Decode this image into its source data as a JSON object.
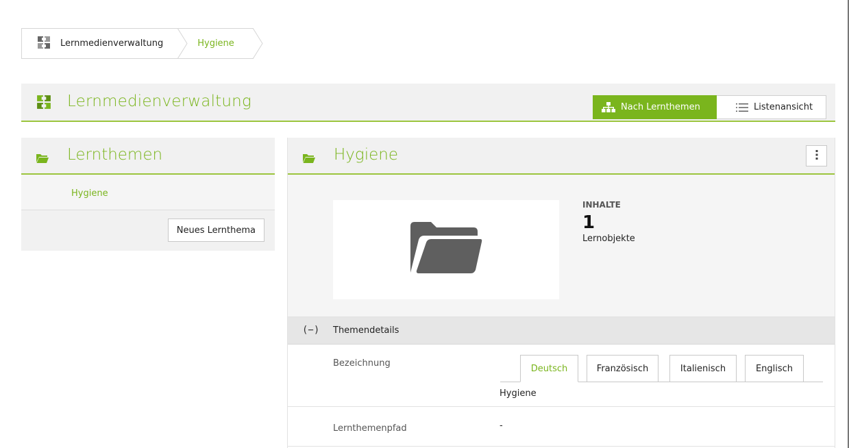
{
  "breadcrumb": {
    "items": [
      {
        "label": "Lernmedienverwaltung",
        "icon": "module-icon"
      },
      {
        "label": "Hygiene"
      }
    ]
  },
  "module": {
    "title": "Lernmedienverwaltung",
    "icon": "module-icon",
    "views": [
      {
        "label": "Nach Lernthemen",
        "icon": "hierarchy-icon",
        "active": true
      },
      {
        "label": "Listenansicht",
        "icon": "list-icon",
        "active": false
      }
    ]
  },
  "left_panel": {
    "title": "Lernthemen",
    "icon": "folder-icon",
    "items": [
      {
        "label": "Hygiene"
      }
    ],
    "new_button": "Neues Lernthema"
  },
  "detail": {
    "title": "Hygiene",
    "icon": "folder-icon",
    "menu_icon": "kebab-menu-icon",
    "thumbnail_icon": "folder-icon",
    "stats": {
      "label": "INHALTE",
      "value": "1",
      "unit": "Lernobjekte"
    },
    "section": {
      "toggle": "(−)",
      "label": "Themendetails"
    },
    "fields": {
      "name_label": "Bezeichnung",
      "tabs": [
        "Deutsch",
        "Französisch",
        "Italienisch",
        "Englisch"
      ],
      "active_tab": "Deutsch",
      "name_value": "Hygiene",
      "path_label": "Lernthemenpfad",
      "path_value": "-"
    }
  },
  "colors": {
    "accent": "#7ab51d",
    "accent_line": "#9bc53d",
    "panel_bg": "#f1f1f1"
  }
}
